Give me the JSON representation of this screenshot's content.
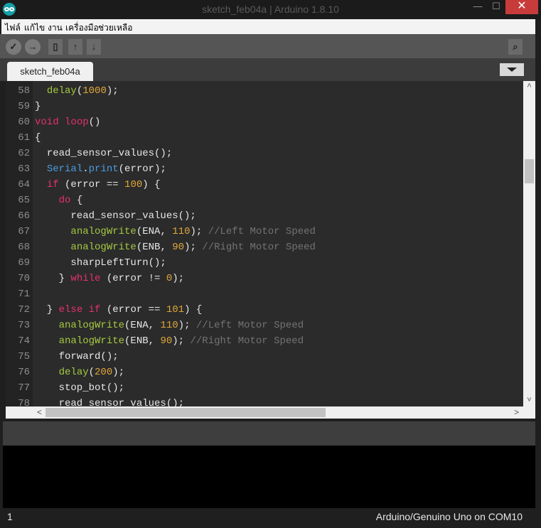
{
  "window": {
    "title": "sketch_feb04a | Arduino 1.8.10",
    "minimize_glyph": "—",
    "maximize_glyph": "☐",
    "close_glyph": "✕"
  },
  "menu": [
    "ไฟล์",
    "แก้ไข",
    "งาน",
    "เครื่องมือ",
    "ช่วยเหลือ"
  ],
  "toolbar": {
    "buttons": [
      "verify-icon",
      "upload-icon",
      "new-icon",
      "open-icon",
      "save-icon",
      "serial-monitor-icon"
    ]
  },
  "tab": {
    "label": "sketch_feb04a"
  },
  "editor": {
    "lines": [
      {
        "num": "58",
        "tokens": [
          {
            "t": "  ",
            "c": ""
          },
          {
            "t": "delay",
            "c": "f"
          },
          {
            "t": "(",
            "c": ""
          },
          {
            "t": "1000",
            "c": "n"
          },
          {
            "t": ");",
            "c": ""
          }
        ]
      },
      {
        "num": "59",
        "tokens": [
          {
            "t": "}",
            "c": ""
          }
        ]
      },
      {
        "num": "60",
        "tokens": [
          {
            "t": "void",
            "c": "k"
          },
          {
            "t": " ",
            "c": ""
          },
          {
            "t": "loop",
            "c": "k"
          },
          {
            "t": "()",
            "c": ""
          }
        ]
      },
      {
        "num": "61",
        "tokens": [
          {
            "t": "{",
            "c": ""
          }
        ]
      },
      {
        "num": "62",
        "tokens": [
          {
            "t": "  read_sensor_values();",
            "c": ""
          }
        ]
      },
      {
        "num": "63",
        "tokens": [
          {
            "t": "  ",
            "c": ""
          },
          {
            "t": "Serial",
            "c": "s"
          },
          {
            "t": ".",
            "c": ""
          },
          {
            "t": "print",
            "c": "s"
          },
          {
            "t": "(error);",
            "c": ""
          }
        ]
      },
      {
        "num": "64",
        "tokens": [
          {
            "t": "  ",
            "c": ""
          },
          {
            "t": "if",
            "c": "k"
          },
          {
            "t": " (error == ",
            "c": ""
          },
          {
            "t": "100",
            "c": "n"
          },
          {
            "t": ") {",
            "c": ""
          }
        ]
      },
      {
        "num": "65",
        "tokens": [
          {
            "t": "    ",
            "c": ""
          },
          {
            "t": "do",
            "c": "k"
          },
          {
            "t": " {",
            "c": ""
          }
        ]
      },
      {
        "num": "66",
        "tokens": [
          {
            "t": "      read_sensor_values();",
            "c": ""
          }
        ]
      },
      {
        "num": "67",
        "tokens": [
          {
            "t": "      ",
            "c": ""
          },
          {
            "t": "analogWrite",
            "c": "f"
          },
          {
            "t": "(ENA, ",
            "c": ""
          },
          {
            "t": "110",
            "c": "n"
          },
          {
            "t": "); ",
            "c": ""
          },
          {
            "t": "//Left Motor Speed",
            "c": "c"
          }
        ]
      },
      {
        "num": "68",
        "tokens": [
          {
            "t": "      ",
            "c": ""
          },
          {
            "t": "analogWrite",
            "c": "f"
          },
          {
            "t": "(ENB, ",
            "c": ""
          },
          {
            "t": "90",
            "c": "n"
          },
          {
            "t": "); ",
            "c": ""
          },
          {
            "t": "//Right Motor Speed",
            "c": "c"
          }
        ]
      },
      {
        "num": "69",
        "tokens": [
          {
            "t": "      sharpLeftTurn();",
            "c": ""
          }
        ]
      },
      {
        "num": "70",
        "tokens": [
          {
            "t": "    } ",
            "c": ""
          },
          {
            "t": "while",
            "c": "k"
          },
          {
            "t": " (error != ",
            "c": ""
          },
          {
            "t": "0",
            "c": "n"
          },
          {
            "t": ");",
            "c": ""
          }
        ]
      },
      {
        "num": "71",
        "tokens": []
      },
      {
        "num": "72",
        "tokens": [
          {
            "t": "  } ",
            "c": ""
          },
          {
            "t": "else",
            "c": "k"
          },
          {
            "t": " ",
            "c": ""
          },
          {
            "t": "if",
            "c": "k"
          },
          {
            "t": " (error == ",
            "c": ""
          },
          {
            "t": "101",
            "c": "n"
          },
          {
            "t": ") {",
            "c": ""
          }
        ]
      },
      {
        "num": "73",
        "tokens": [
          {
            "t": "    ",
            "c": ""
          },
          {
            "t": "analogWrite",
            "c": "f"
          },
          {
            "t": "(ENA, ",
            "c": ""
          },
          {
            "t": "110",
            "c": "n"
          },
          {
            "t": "); ",
            "c": ""
          },
          {
            "t": "//Left Motor Speed",
            "c": "c"
          }
        ]
      },
      {
        "num": "74",
        "tokens": [
          {
            "t": "    ",
            "c": ""
          },
          {
            "t": "analogWrite",
            "c": "f"
          },
          {
            "t": "(ENB, ",
            "c": ""
          },
          {
            "t": "90",
            "c": "n"
          },
          {
            "t": "); ",
            "c": ""
          },
          {
            "t": "//Right Motor Speed",
            "c": "c"
          }
        ]
      },
      {
        "num": "75",
        "tokens": [
          {
            "t": "    forward();",
            "c": ""
          }
        ]
      },
      {
        "num": "76",
        "tokens": [
          {
            "t": "    ",
            "c": ""
          },
          {
            "t": "delay",
            "c": "f"
          },
          {
            "t": "(",
            "c": ""
          },
          {
            "t": "200",
            "c": "n"
          },
          {
            "t": ");",
            "c": ""
          }
        ]
      },
      {
        "num": "77",
        "tokens": [
          {
            "t": "    stop_bot();",
            "c": ""
          }
        ]
      },
      {
        "num": "78",
        "tokens": [
          {
            "t": "    read_sensor_values();",
            "c": ""
          }
        ]
      }
    ]
  },
  "scroll": {
    "up_glyph": "˄",
    "down_glyph": "˅",
    "left_glyph": "<",
    "right_glyph": ">"
  },
  "status": {
    "line": "1",
    "board": "Arduino/Genuino Uno on COM10"
  },
  "colors": {
    "keyword": "#e6306e",
    "function": "#a4c940",
    "number": "#e0a73a",
    "serial": "#4b9be0",
    "comment": "#737373",
    "text": "#e8e8e8",
    "editor_bg": "#2b2b2b",
    "accent": "#15a0a8"
  }
}
